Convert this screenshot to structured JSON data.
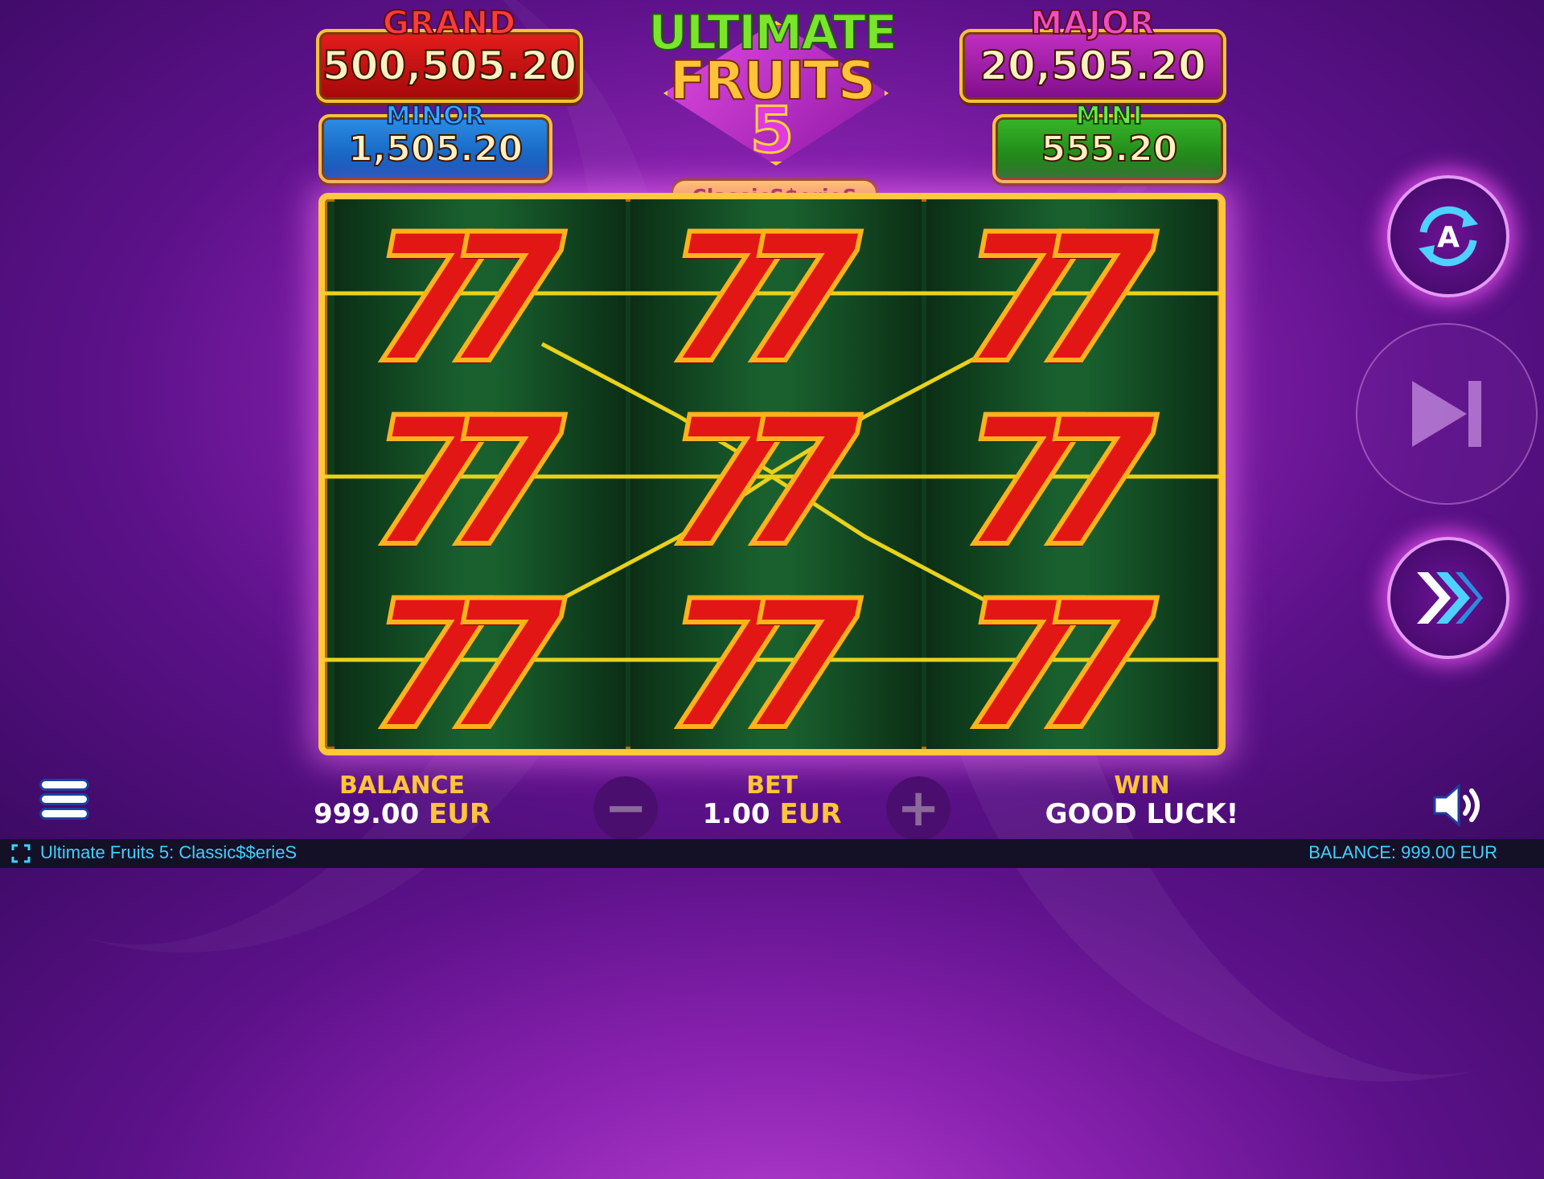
{
  "jackpots": {
    "grand": {
      "label": "GRAND",
      "value": "500,505.20"
    },
    "major": {
      "label": "MAJOR",
      "value": "20,505.20"
    },
    "minor": {
      "label": "MINOR",
      "value": "1,505.20"
    },
    "mini": {
      "label": "MINI",
      "value": "555.20"
    }
  },
  "logo": {
    "line1": "ULTIMATE",
    "line2": "FRUITS",
    "line3": "5"
  },
  "series_badge": "ClassicS$erieS",
  "reels": {
    "symbol": "77",
    "grid": [
      [
        "77",
        "77",
        "77"
      ],
      [
        "77",
        "77",
        "77"
      ],
      [
        "77",
        "77",
        "77"
      ]
    ]
  },
  "side_buttons": {
    "autoplay_icon": "autoplay-icon",
    "skip_icon": "skip-icon",
    "turbo_icon": "turbo-icon",
    "autoplay_letter": "A"
  },
  "bottom": {
    "balance_label": "BALANCE",
    "balance_amount": "999.00",
    "balance_currency": "EUR",
    "bet_label": "BET",
    "bet_amount": "1.00",
    "bet_currency": "EUR",
    "win_label": "WIN",
    "win_value": "GOOD LUCK!",
    "minus": "−",
    "plus": "+"
  },
  "statusbar": {
    "title": "Ultimate Fruits 5: Classic$$erieS",
    "balance": "BALANCE: 999.00 EUR"
  },
  "colors": {
    "accent_gold": "#ffc43a",
    "status_text": "#3fd2ff",
    "reel_bg": "#19602e",
    "symbol_red": "#e31616"
  }
}
